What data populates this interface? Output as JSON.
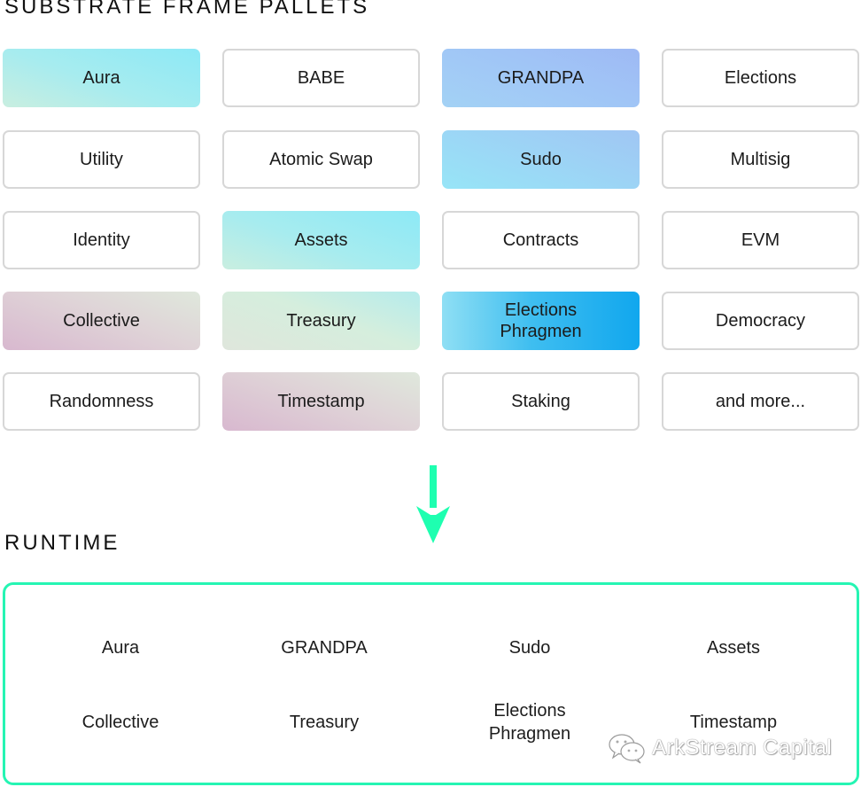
{
  "pallets_section": {
    "title": "SUBSTRATE FRAME PALLETS",
    "items": [
      {
        "label": "Aura",
        "style": "cyan"
      },
      {
        "label": "BABE",
        "style": "outline"
      },
      {
        "label": "GRANDPA",
        "style": "blue"
      },
      {
        "label": "Elections",
        "style": "outline"
      },
      {
        "label": "Utility",
        "style": "outline"
      },
      {
        "label": "Atomic Swap",
        "style": "outline"
      },
      {
        "label": "Sudo",
        "style": "skyblue"
      },
      {
        "label": "Multisig",
        "style": "outline"
      },
      {
        "label": "Identity",
        "style": "outline"
      },
      {
        "label": "Assets",
        "style": "cyan"
      },
      {
        "label": "Contracts",
        "style": "outline"
      },
      {
        "label": "EVM",
        "style": "outline"
      },
      {
        "label": "Collective",
        "style": "pink"
      },
      {
        "label": "Treasury",
        "style": "mint"
      },
      {
        "label": "Elections\nPhragmen",
        "style": "deepblue"
      },
      {
        "label": "Democracy",
        "style": "outline"
      },
      {
        "label": "Randomness",
        "style": "outline"
      },
      {
        "label": "Timestamp",
        "style": "pink"
      },
      {
        "label": "Staking",
        "style": "outline"
      },
      {
        "label": "and more...",
        "style": "outline"
      }
    ]
  },
  "arrow": {
    "icon": "arrow-down-icon",
    "color": "#1effb0"
  },
  "runtime_section": {
    "title": "RUNTIME",
    "border_color": "#25f5b3",
    "items": [
      {
        "label": "Aura"
      },
      {
        "label": "GRANDPA"
      },
      {
        "label": "Sudo"
      },
      {
        "label": "Assets"
      },
      {
        "label": "Collective"
      },
      {
        "label": "Treasury"
      },
      {
        "label": "Elections\nPhragmen"
      },
      {
        "label": "Timestamp"
      }
    ]
  },
  "watermark": {
    "icon": "wechat-icon",
    "text": "ArkStream Capital"
  }
}
